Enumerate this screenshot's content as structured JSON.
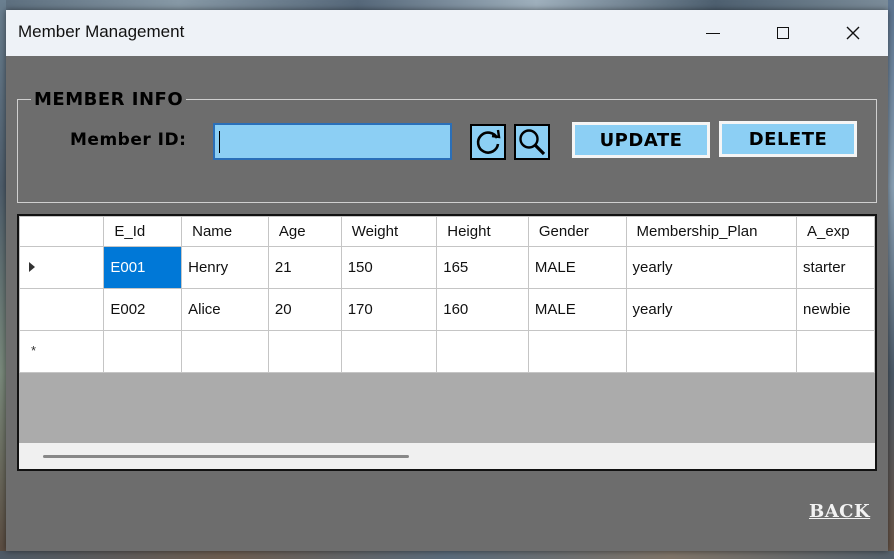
{
  "window": {
    "title": "Member Management"
  },
  "member_info": {
    "legend": "MEMBER INFO",
    "member_id_label": "Member ID:",
    "member_id_value": "",
    "update_label": "UPDATE",
    "delete_label": "DELETE",
    "refresh_icon": "refresh-icon",
    "search_icon": "search-icon"
  },
  "grid": {
    "columns": [
      "E_Id",
      "Name",
      "Age",
      "Weight",
      "Height",
      "Gender",
      "Membership_Plan",
      "A_exp"
    ],
    "rows": [
      [
        "E001",
        "Henry",
        "21",
        "150",
        "165",
        "MALE",
        "yearly",
        "starter"
      ],
      [
        "E002",
        "Alice",
        "20",
        "170",
        "160",
        "MALE",
        "yearly",
        "newbie"
      ]
    ],
    "new_row_marker": "*",
    "selected_cell": "E001"
  },
  "footer": {
    "back_label": "BACK"
  },
  "colors": {
    "accent": "#8ccff4",
    "selection": "#0078d7",
    "window_bg": "#6d6d6d"
  }
}
